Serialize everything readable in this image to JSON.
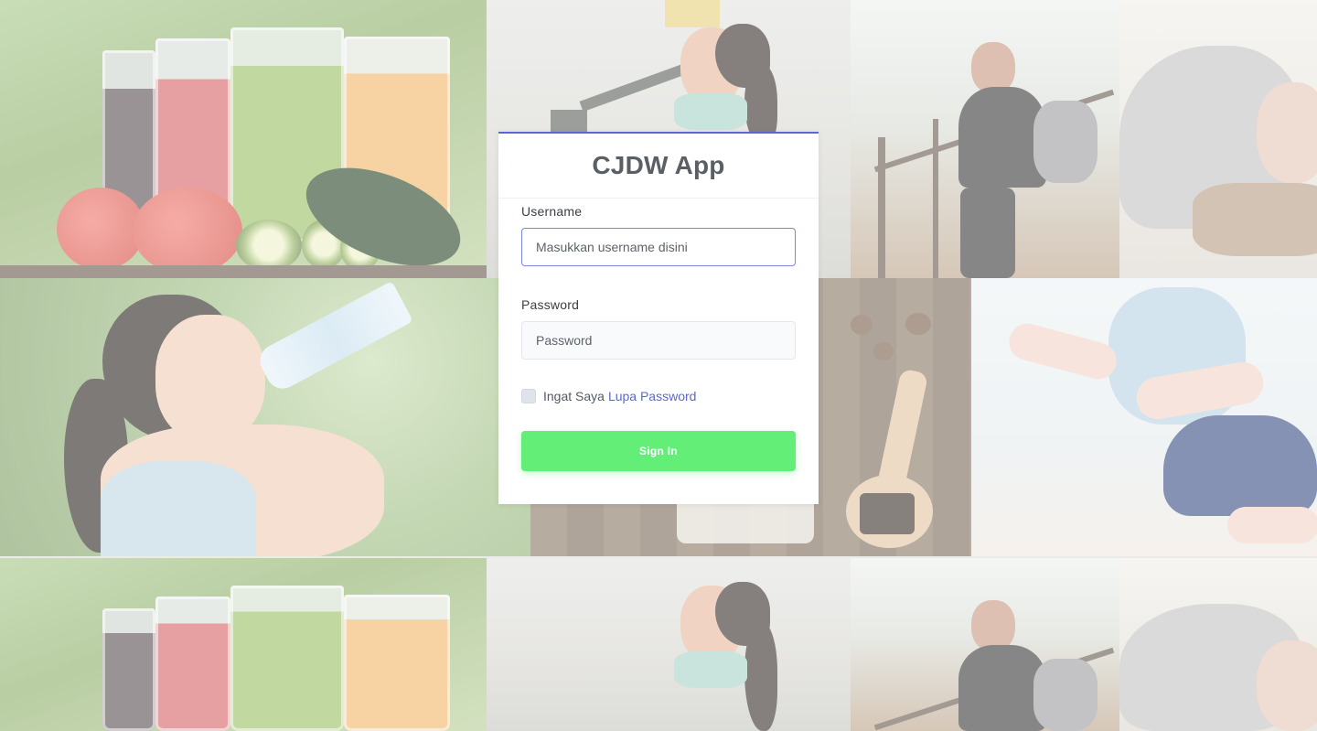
{
  "app": {
    "title": "CJDW App"
  },
  "login_form": {
    "username": {
      "label": "Username",
      "placeholder": "Masukkan username disini",
      "value": ""
    },
    "password": {
      "label": "Password",
      "placeholder": "Password",
      "value": ""
    },
    "remember": {
      "label": "Ingat Saya",
      "checked": false
    },
    "forgot_link": "Lupa Password",
    "submit_label": "Sign In"
  },
  "background": {
    "tiles": [
      "juices",
      "gym-woman",
      "cyclist",
      "sleeping-man",
      "woman-drinking-water",
      "spoon-on-wood",
      "yoga",
      "juices",
      "gym-woman",
      "cyclist",
      "sleeping-man"
    ]
  },
  "colors": {
    "accent": "#5967d6",
    "button": "#63ee78",
    "card_bg": "#ffffff",
    "title_text": "#5a5f66"
  },
  "icons": {
    "checkbox": "checkbox-unchecked-icon"
  }
}
